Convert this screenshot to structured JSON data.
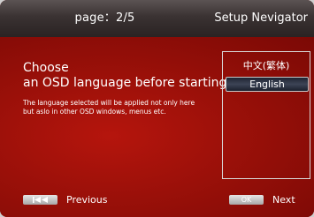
{
  "header": {
    "page": "page：2/5",
    "title": "Setup Nevigator"
  },
  "main": {
    "headline": [
      "Choose",
      "an OSD language before starting."
    ],
    "description": [
      "The language selected will be applied not only here",
      "but aslo in other OSD windows, menus etc."
    ]
  },
  "languages": [
    {
      "label": "中文(繁体)",
      "selected": false
    },
    {
      "label": "English",
      "selected": true
    }
  ],
  "footer": {
    "previous": {
      "label": "Previous",
      "icon": "skip-previous-icon"
    },
    "next": {
      "label": "Next",
      "icon_text": "OK"
    }
  },
  "colors": {
    "background": "#9a1009",
    "header": "#3a3232",
    "selected_item": "#3d4456",
    "text": "#ffffff"
  }
}
